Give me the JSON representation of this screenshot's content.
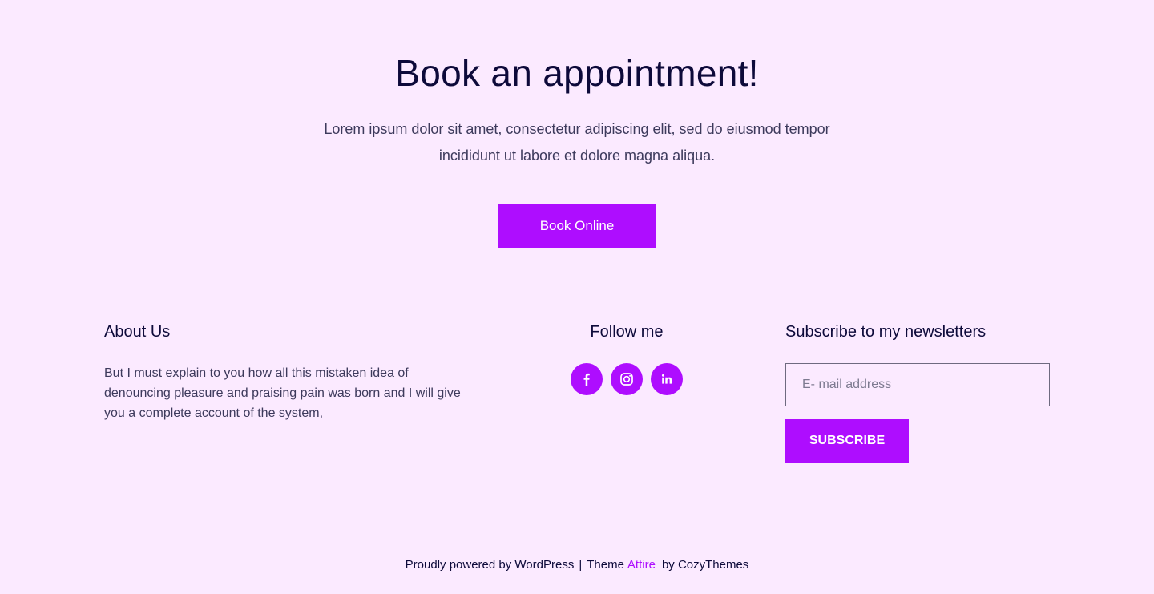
{
  "cta": {
    "title": "Book an appointment!",
    "description": "Lorem ipsum dolor sit amet, consectetur adipiscing elit, sed do eiusmod tempor incididunt ut labore et dolore magna aliqua.",
    "button_label": "Book Online"
  },
  "about": {
    "title": "About Us",
    "text": "But I must explain to you how all this mistaken idea of denouncing pleasure and praising pain was born and I will give you a complete account of the system,"
  },
  "follow": {
    "title": "Follow me",
    "icons": [
      "facebook-icon",
      "instagram-icon",
      "linkedin-icon"
    ]
  },
  "newsletter": {
    "title": "Subscribe to my newsletters",
    "email_placeholder": "E- mail address",
    "button_label": "SUBSCRIBE"
  },
  "footer": {
    "powered_by": "Proudly powered by WordPress",
    "separator": "|",
    "theme_prefix": "Theme",
    "theme_name": "Attire",
    "author_text": "by CozyThemes"
  },
  "colors": {
    "accent": "#ae0dff",
    "background": "#fbeaff",
    "heading": "#0d0a3a",
    "body_text": "#3d3a5c"
  }
}
